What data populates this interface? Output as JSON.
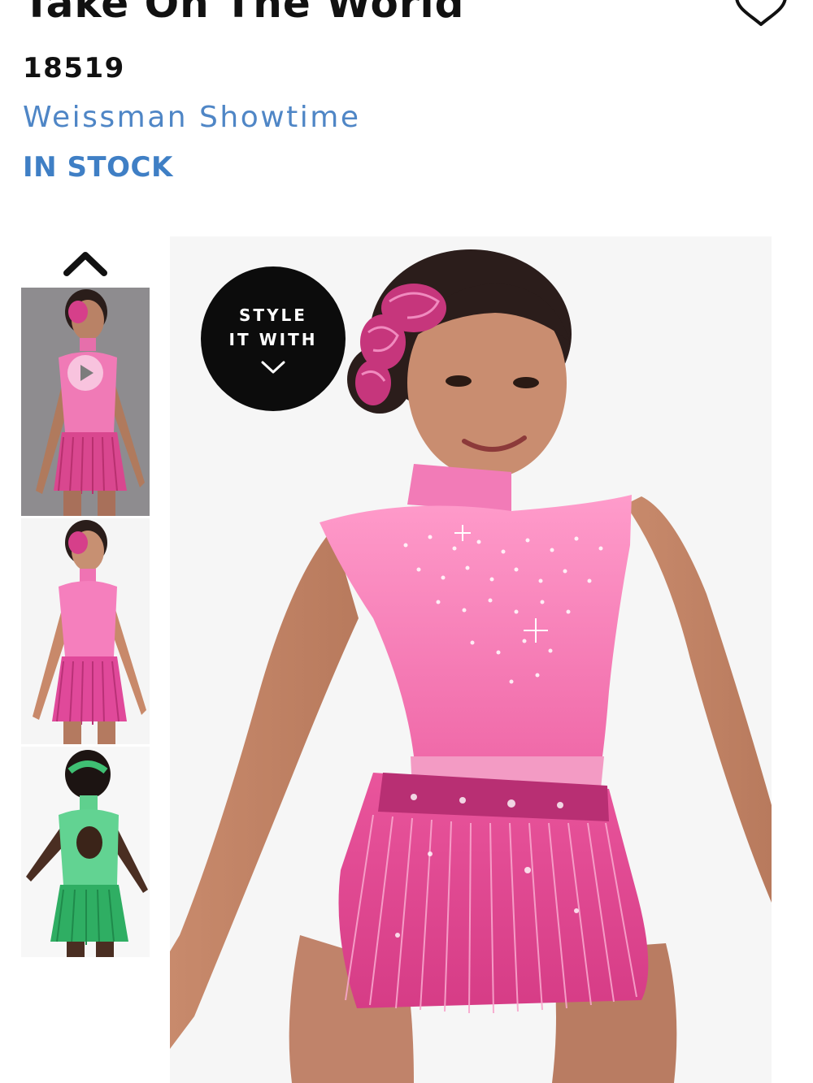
{
  "product": {
    "title": "Take On The World",
    "sku": "18519",
    "brand": "Weissman Showtime",
    "stock_status": "IN STOCK"
  },
  "badge": {
    "line1": "STYLE",
    "line2": "IT WITH",
    "icon": "chevron-down-icon"
  },
  "gallery": {
    "thumbnails": [
      {
        "variant": "pink",
        "has_video": true
      },
      {
        "variant": "pink",
        "has_video": false
      },
      {
        "variant": "green",
        "has_video": false
      }
    ],
    "icons": {
      "scroll_up": "chevron-up-icon",
      "wishlist": "heart-icon",
      "video": "play-icon"
    }
  },
  "colors": {
    "brand_blue": "#4f86c6",
    "stock_blue": "#3f7fc5",
    "costume_pink": "#ec5f9e",
    "costume_green": "#3fc47a"
  }
}
